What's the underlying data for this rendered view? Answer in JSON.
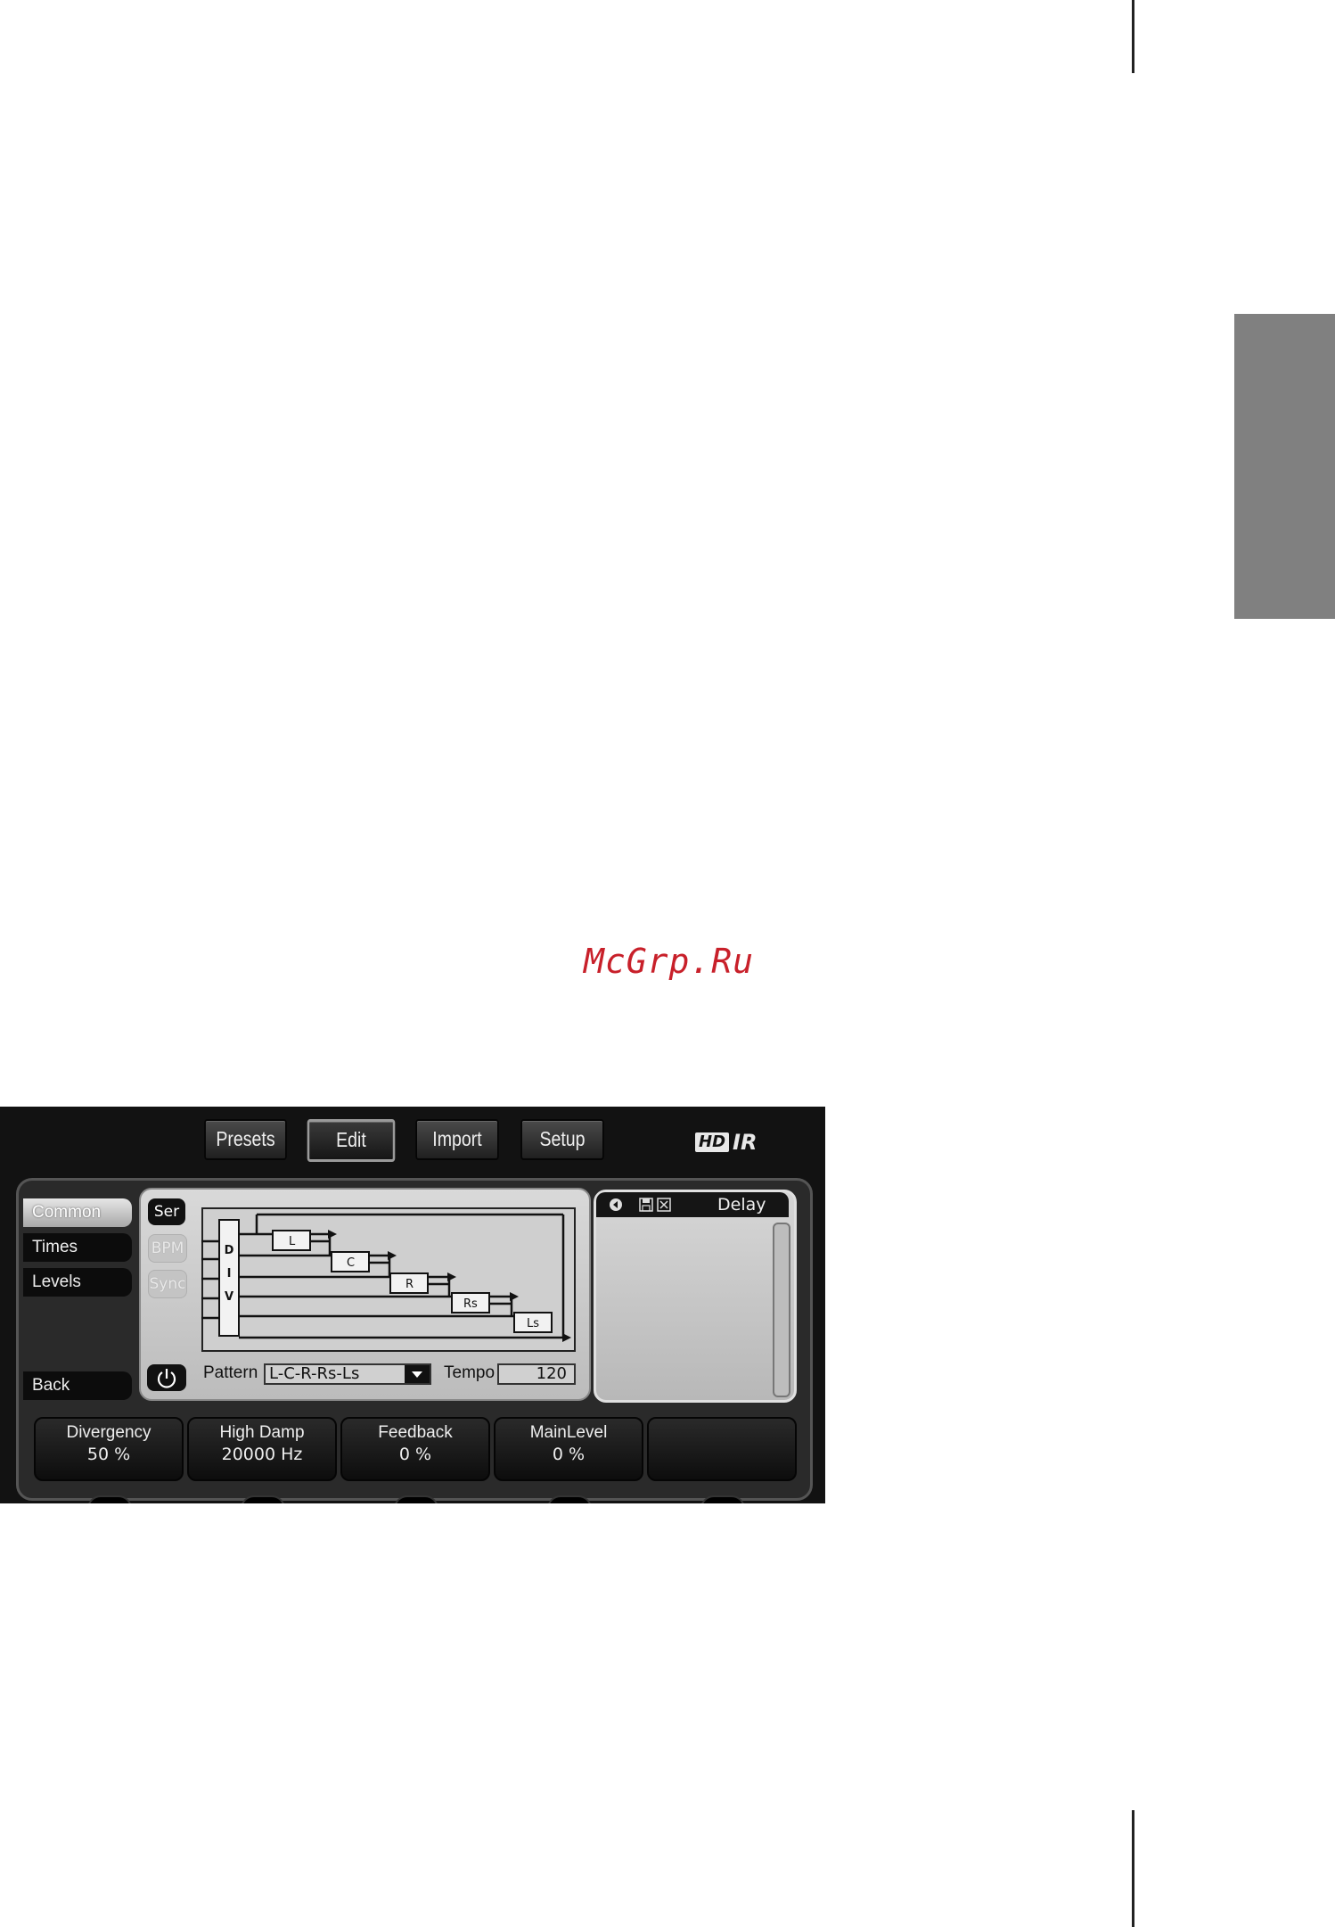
{
  "watermark": "McGrp.Ru",
  "plugin": {
    "top_tabs": [
      {
        "label": "Presets"
      },
      {
        "label": "Edit"
      },
      {
        "label": "Import"
      },
      {
        "label": "Setup"
      }
    ],
    "logo": {
      "hd": "HD",
      "ir": "IR"
    },
    "left_menu": {
      "items": [
        {
          "label": "Common"
        },
        {
          "label": "Times"
        },
        {
          "label": "Levels"
        }
      ],
      "back_label": "Back"
    },
    "mode_buttons": [
      {
        "label": "Ser"
      },
      {
        "label": "BPM"
      },
      {
        "label": "Sync"
      }
    ],
    "diagram": {
      "div_label": [
        "D",
        "I",
        "V"
      ],
      "taps": [
        "L",
        "C",
        "R",
        "Rs",
        "Ls"
      ]
    },
    "pattern": {
      "label": "Pattern",
      "value": "L-C-R-Rs-Ls"
    },
    "tempo": {
      "label": "Tempo",
      "value": "120"
    },
    "right_panel": {
      "title": "Delay"
    },
    "knobs": [
      {
        "name": "Divergency",
        "value": "50 %"
      },
      {
        "name": "High Damp",
        "value": "20000 Hz"
      },
      {
        "name": "Feedback",
        "value": "0 %"
      },
      {
        "name": "MainLevel",
        "value": "0 %"
      },
      {
        "name": "",
        "value": ""
      }
    ]
  }
}
